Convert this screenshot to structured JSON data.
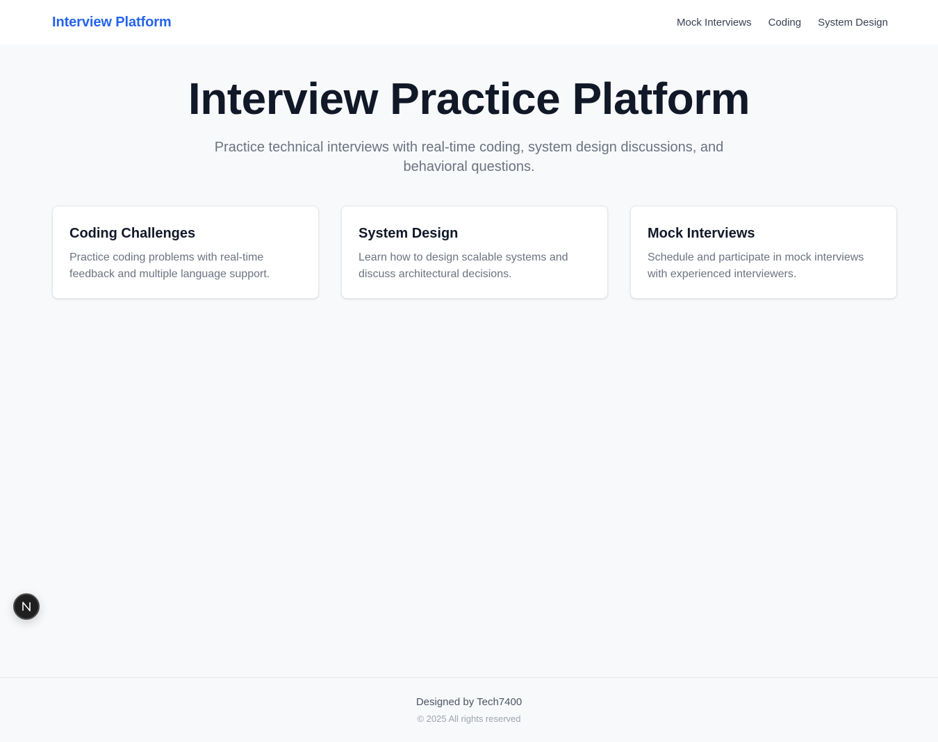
{
  "header": {
    "brand": "Interview Platform",
    "nav": [
      {
        "label": "Mock Interviews"
      },
      {
        "label": "Coding"
      },
      {
        "label": "System Design"
      }
    ]
  },
  "hero": {
    "title": "Interview Practice Platform",
    "subtitle": "Practice technical interviews with real-time coding, system design discussions, and behavioral questions."
  },
  "cards": [
    {
      "title": "Coding Challenges",
      "description": "Practice coding problems with real-time feedback and multiple language support."
    },
    {
      "title": "System Design",
      "description": "Learn how to design scalable systems and discuss architectural decisions."
    },
    {
      "title": "Mock Interviews",
      "description": "Schedule and participate in mock interviews with experienced interviewers."
    }
  ],
  "fab": {
    "icon": "nextjs-logo-icon"
  },
  "footer": {
    "credit": "Designed by Tech7400",
    "copyright": "© 2025 All rights reserved"
  },
  "colors": {
    "brand": "#2563eb",
    "background": "#f8f9fb",
    "heading": "#111827",
    "muted": "#6b7280"
  }
}
